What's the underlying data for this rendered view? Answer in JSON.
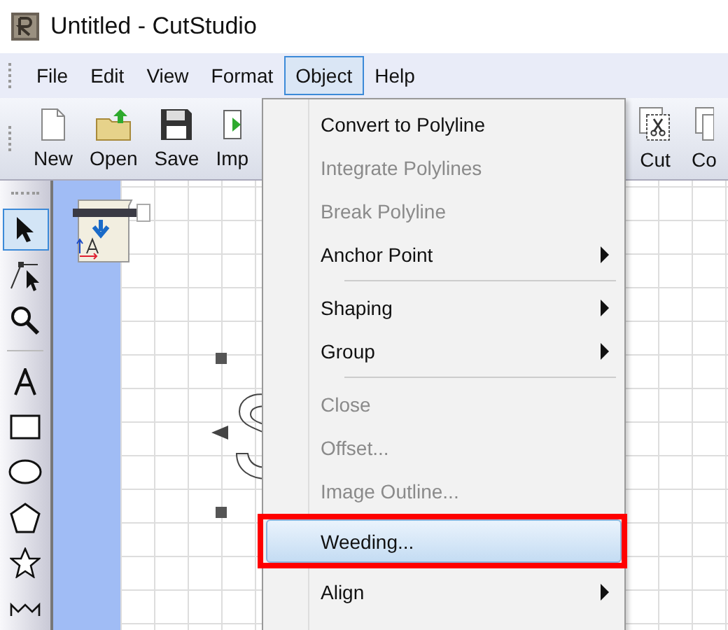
{
  "window": {
    "title": "Untitled - CutStudio"
  },
  "menubar": [
    {
      "label": "File",
      "selected": false
    },
    {
      "label": "Edit",
      "selected": false
    },
    {
      "label": "View",
      "selected": false
    },
    {
      "label": "Format",
      "selected": false
    },
    {
      "label": "Object",
      "selected": true
    },
    {
      "label": "Help",
      "selected": false
    }
  ],
  "toolbar": {
    "left": [
      {
        "label": "New"
      },
      {
        "label": "Open"
      },
      {
        "label": "Save"
      },
      {
        "label": "Imp"
      }
    ],
    "right": [
      {
        "label": "Cut"
      },
      {
        "label": "Co"
      }
    ]
  },
  "tools": [
    {
      "kind": "select",
      "selected": true
    },
    {
      "kind": "node",
      "selected": false
    },
    {
      "kind": "zoom",
      "selected": false
    },
    {
      "kind": "text",
      "selected": false
    },
    {
      "kind": "rectangle",
      "selected": false
    },
    {
      "kind": "ellipse",
      "selected": false
    },
    {
      "kind": "pentagon",
      "selected": false
    },
    {
      "kind": "star",
      "selected": false
    },
    {
      "kind": "freehand",
      "selected": false
    }
  ],
  "object_menu": [
    {
      "kind": "item",
      "label": "Convert to Polyline",
      "disabled": false,
      "submenu": false,
      "selected": false,
      "highlighted": false
    },
    {
      "kind": "item",
      "label": "Integrate Polylines",
      "disabled": true,
      "submenu": false,
      "selected": false,
      "highlighted": false
    },
    {
      "kind": "item",
      "label": "Break Polyline",
      "disabled": true,
      "submenu": false,
      "selected": false,
      "highlighted": false
    },
    {
      "kind": "item",
      "label": "Anchor Point",
      "disabled": false,
      "submenu": true,
      "selected": false,
      "highlighted": false
    },
    {
      "kind": "separator"
    },
    {
      "kind": "item",
      "label": "Shaping",
      "disabled": false,
      "submenu": true,
      "selected": false,
      "highlighted": false
    },
    {
      "kind": "item",
      "label": "Group",
      "disabled": false,
      "submenu": true,
      "selected": false,
      "highlighted": false
    },
    {
      "kind": "separator"
    },
    {
      "kind": "item",
      "label": "Close",
      "disabled": true,
      "submenu": false,
      "selected": false,
      "highlighted": false
    },
    {
      "kind": "item",
      "label": "Offset...",
      "disabled": true,
      "submenu": false,
      "selected": false,
      "highlighted": false
    },
    {
      "kind": "item",
      "label": "Image Outline...",
      "disabled": true,
      "submenu": false,
      "selected": false,
      "highlighted": false
    },
    {
      "kind": "item",
      "label": "Weeding...",
      "disabled": false,
      "submenu": false,
      "selected": true,
      "highlighted": true
    },
    {
      "kind": "item",
      "label": "Align",
      "disabled": false,
      "submenu": true,
      "selected": false,
      "highlighted": false
    }
  ]
}
